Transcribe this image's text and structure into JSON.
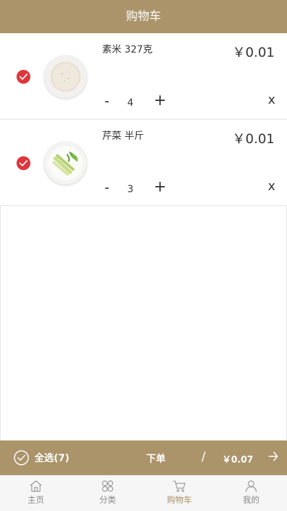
{
  "header": {
    "title": "购物车"
  },
  "items": [
    {
      "name": "素米 327克",
      "price": "￥0.01",
      "qty": "4",
      "minus": "-",
      "plus": "+",
      "remove": "x",
      "image": "rice-bowl"
    },
    {
      "name": "芹菜 半斤",
      "price": "￥0.01",
      "qty": "3",
      "minus": "-",
      "plus": "+",
      "remove": "x",
      "image": "celery-plate"
    }
  ],
  "bottom_bar": {
    "select_all": "全选(7)",
    "order": "下单",
    "separator": "/",
    "total": "￥0.07"
  },
  "tabs": [
    {
      "label": "主页",
      "icon": "home-icon",
      "active": false
    },
    {
      "label": "分类",
      "icon": "category-icon",
      "active": false
    },
    {
      "label": "购物车",
      "icon": "cart-icon",
      "active": true
    },
    {
      "label": "我的",
      "icon": "user-icon",
      "active": false
    }
  ],
  "colors": {
    "brand": "#ab936a",
    "check": "#e0353b",
    "tab_inactive": "#888888"
  }
}
